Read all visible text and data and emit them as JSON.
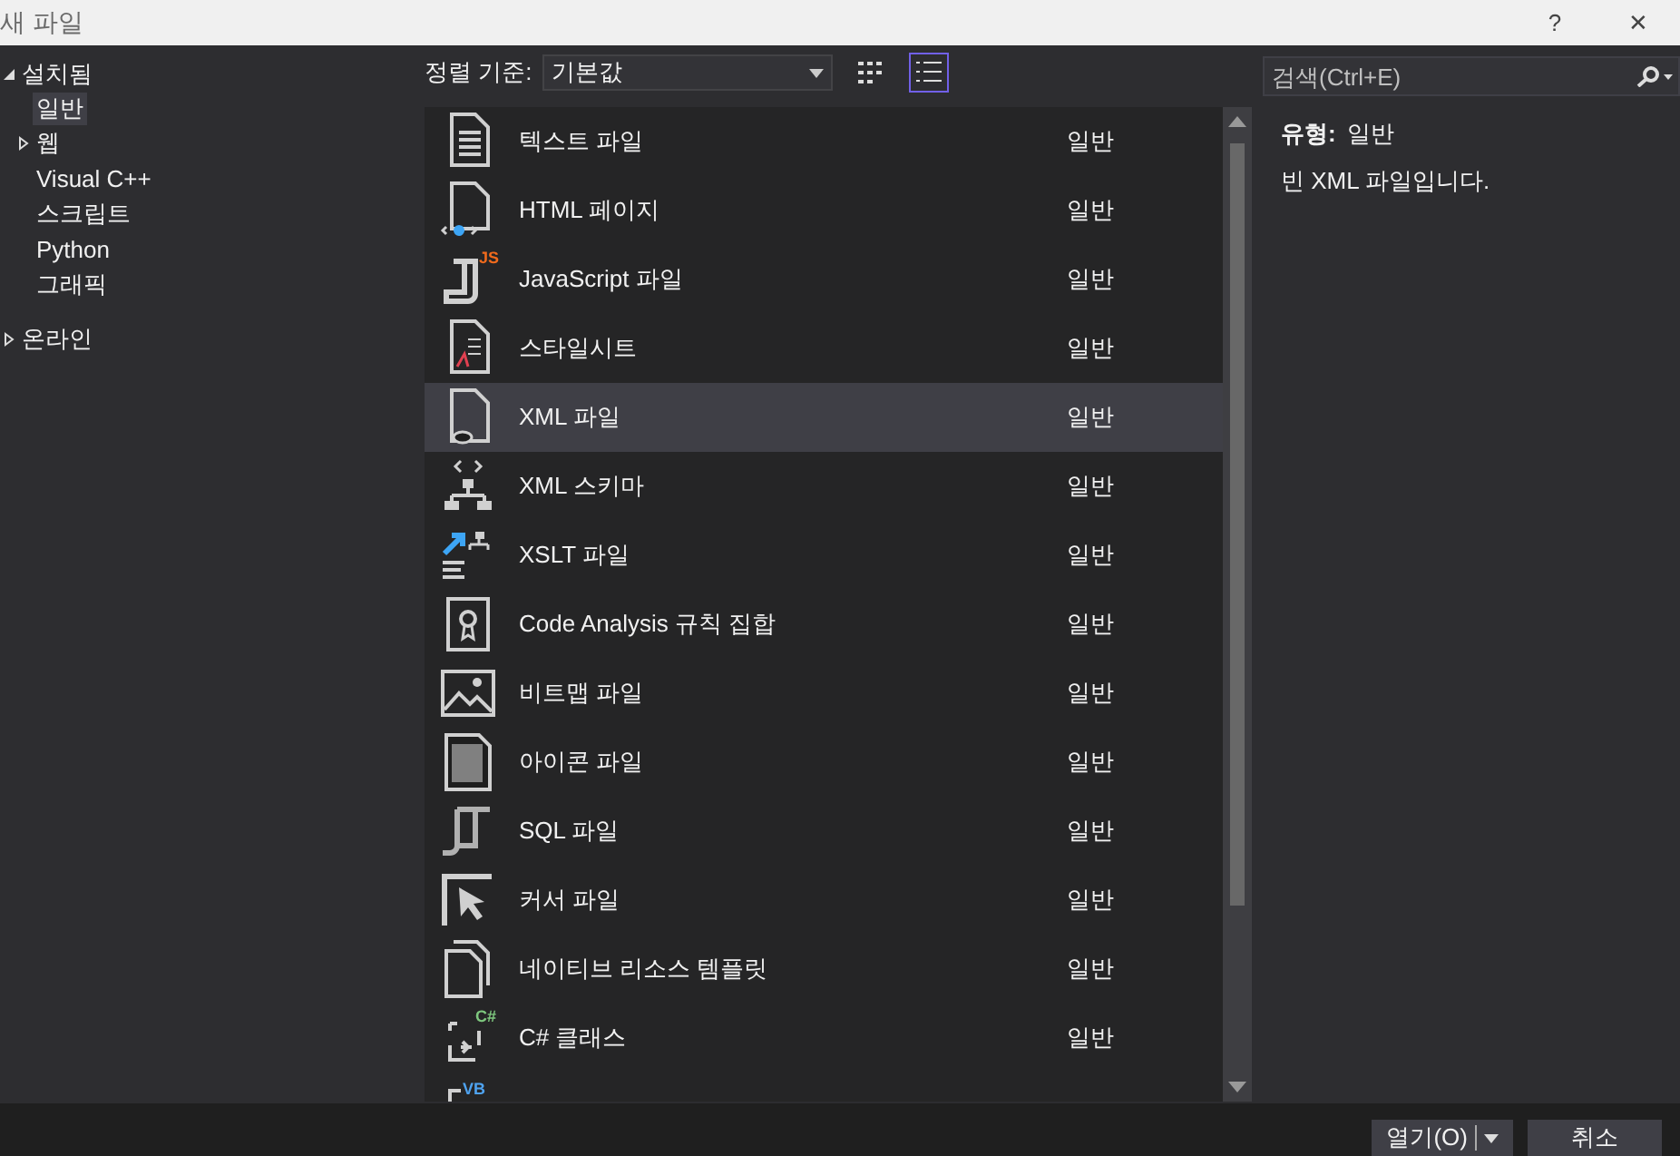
{
  "window": {
    "title": "새 파일",
    "help": "?",
    "close": "✕"
  },
  "sidebar": {
    "items": [
      {
        "label": "설치됨",
        "expanded": true,
        "selected": false,
        "children": [
          {
            "label": "일반",
            "selected": true
          },
          {
            "label": "웹",
            "expanded": false,
            "selected": false
          },
          {
            "label": "Visual C++",
            "selected": false
          },
          {
            "label": "스크립트",
            "selected": false
          },
          {
            "label": "Python",
            "selected": false
          },
          {
            "label": "그래픽",
            "selected": false
          }
        ]
      },
      {
        "label": "온라인",
        "expanded": false,
        "selected": false
      }
    ]
  },
  "toolbar": {
    "sort_label": "정렬 기준:",
    "sort_value": "기본값",
    "views": [
      {
        "kind": "grid",
        "selected": false
      },
      {
        "kind": "list",
        "selected": true
      }
    ]
  },
  "templates": [
    {
      "name": "텍스트 파일",
      "category": "일반",
      "selected": false
    },
    {
      "name": "HTML 페이지",
      "category": "일반",
      "selected": false
    },
    {
      "name": "JavaScript 파일",
      "category": "일반",
      "badge": "JS",
      "selected": false
    },
    {
      "name": "스타일시트",
      "category": "일반",
      "selected": false
    },
    {
      "name": "XML 파일",
      "category": "일반",
      "selected": true
    },
    {
      "name": "XML 스키마",
      "category": "일반",
      "selected": false
    },
    {
      "name": "XSLT 파일",
      "category": "일반",
      "selected": false
    },
    {
      "name": "Code Analysis 규칙 집합",
      "category": "일반",
      "selected": false
    },
    {
      "name": "비트맵 파일",
      "category": "일반",
      "selected": false
    },
    {
      "name": "아이콘 파일",
      "category": "일반",
      "selected": false
    },
    {
      "name": "SQL 파일",
      "category": "일반",
      "selected": false
    },
    {
      "name": "커서 파일",
      "category": "일반",
      "selected": false
    },
    {
      "name": "네이티브 리소스 템플릿",
      "category": "일반",
      "selected": false
    },
    {
      "name": "C# 클래스",
      "category": "일반",
      "badge": "C#",
      "selected": false
    },
    {
      "badge": "VB",
      "selected": false
    }
  ],
  "search": {
    "placeholder": "검색(Ctrl+E)"
  },
  "details": {
    "type_label": "유형:",
    "type_value": "일반",
    "description": "빈 XML 파일입니다."
  },
  "buttons": {
    "open": "열기(O)",
    "cancel": "취소"
  }
}
